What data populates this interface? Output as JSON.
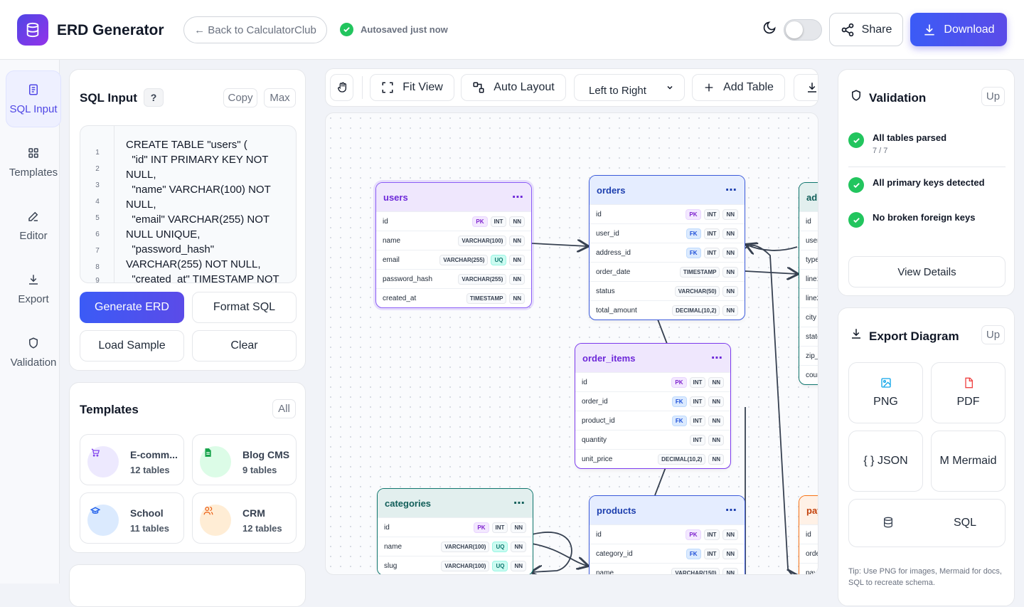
{
  "header": {
    "title": "ERD Generator",
    "back_label": "← Back to CalculatorClub",
    "autosave_text": "Autosaved just now",
    "share_label": "Share",
    "download_label": "Download",
    "accent": "#4f46e5"
  },
  "rail": [
    "SQL Input",
    "Templates",
    "Editor",
    "Export",
    "Validation"
  ],
  "sql_input": {
    "title": "SQL Input",
    "help": "?",
    "copy_label": "Copy",
    "max_label": "Max",
    "line_numbers": [
      "1",
      "2",
      "3",
      "4",
      "5",
      "6",
      "7",
      "8",
      "9"
    ],
    "code": "CREATE TABLE \"users\" (\n  \"id\" INT PRIMARY KEY NOT NULL,\n  \"name\" VARCHAR(100) NOT NULL,\n  \"email\" VARCHAR(255) NOT NULL UNIQUE,\n  \"password_hash\" VARCHAR(255) NOT NULL,\n  \"created_at\" TIMESTAMP NOT NULL",
    "generate": "Generate ERD",
    "format": "Format SQL",
    "load_sample": "Load Sample",
    "clear": "Clear"
  },
  "templates": {
    "title": "Templates",
    "all_label": "All",
    "items": [
      {
        "name": "E-comm...",
        "count": "12 tables"
      },
      {
        "name": "Blog CMS",
        "count": "9 tables"
      },
      {
        "name": "School",
        "count": "11 tables"
      },
      {
        "name": "CRM",
        "count": "12 tables"
      }
    ]
  },
  "toolbar": {
    "fit_view": "Fit View",
    "auto_layout": "Auto Layout",
    "direction": "Left to Right",
    "add_table": "Add Table"
  },
  "diagram": {
    "tables": [
      {
        "name": "users",
        "columns": [
          {
            "n": "id",
            "b": [
              "PK",
              "INT",
              "NN"
            ]
          },
          {
            "n": "name",
            "b": [
              "VARCHAR(100)",
              "NN"
            ]
          },
          {
            "n": "email",
            "b": [
              "VARCHAR(255)",
              "UQ",
              "NN"
            ]
          },
          {
            "n": "password_hash",
            "b": [
              "VARCHAR(255)",
              "NN"
            ]
          },
          {
            "n": "created_at",
            "b": [
              "TIMESTAMP",
              "NN"
            ]
          }
        ]
      },
      {
        "name": "orders",
        "columns": [
          {
            "n": "id",
            "b": [
              "PK",
              "INT",
              "NN"
            ]
          },
          {
            "n": "user_id",
            "b": [
              "FK",
              "INT",
              "NN"
            ]
          },
          {
            "n": "address_id",
            "b": [
              "FK",
              "INT",
              "NN"
            ]
          },
          {
            "n": "order_date",
            "b": [
              "TIMESTAMP",
              "NN"
            ]
          },
          {
            "n": "status",
            "b": [
              "VARCHAR(50)",
              "NN"
            ]
          },
          {
            "n": "total_amount",
            "b": [
              "DECIMAL(10,2)",
              "NN"
            ]
          }
        ]
      },
      {
        "name": "order_items",
        "columns": [
          {
            "n": "id",
            "b": [
              "PK",
              "INT",
              "NN"
            ]
          },
          {
            "n": "order_id",
            "b": [
              "FK",
              "INT",
              "NN"
            ]
          },
          {
            "n": "product_id",
            "b": [
              "FK",
              "INT",
              "NN"
            ]
          },
          {
            "n": "quantity",
            "b": [
              "INT",
              "NN"
            ]
          },
          {
            "n": "unit_price",
            "b": [
              "DECIMAL(10,2)",
              "NN"
            ]
          }
        ]
      },
      {
        "name": "categories",
        "columns": [
          {
            "n": "id",
            "b": [
              "PK",
              "INT",
              "NN"
            ]
          },
          {
            "n": "name",
            "b": [
              "VARCHAR(100)",
              "UQ",
              "NN"
            ]
          },
          {
            "n": "slug",
            "b": [
              "VARCHAR(100)",
              "UQ",
              "NN"
            ]
          }
        ]
      },
      {
        "name": "products",
        "columns": [
          {
            "n": "id",
            "b": [
              "PK",
              "INT",
              "NN"
            ]
          },
          {
            "n": "category_id",
            "b": [
              "FK",
              "INT",
              "NN"
            ]
          },
          {
            "n": "name",
            "b": [
              "VARCHAR(150)",
              "NN"
            ]
          }
        ]
      },
      {
        "name": "ad",
        "columns": [
          {
            "n": "id",
            "b": []
          },
          {
            "n": "user",
            "b": []
          },
          {
            "n": "type",
            "b": []
          },
          {
            "n": "line1",
            "b": []
          },
          {
            "n": "line2",
            "b": []
          },
          {
            "n": "city",
            "b": []
          },
          {
            "n": "state",
            "b": []
          },
          {
            "n": "zip_c",
            "b": []
          },
          {
            "n": "coun",
            "b": []
          }
        ]
      },
      {
        "name": "pay",
        "columns": [
          {
            "n": "id",
            "b": []
          },
          {
            "n": "orde",
            "b": []
          },
          {
            "n": "pay",
            "b": []
          }
        ]
      }
    ]
  },
  "validation": {
    "title": "Validation",
    "up_label": "Up",
    "items": [
      {
        "title": "All tables parsed",
        "sub": "7 / 7"
      },
      {
        "title": "All primary keys detected",
        "sub": ""
      },
      {
        "title": "No broken foreign keys",
        "sub": ""
      }
    ],
    "view_details": "View Details"
  },
  "export": {
    "title": "Export Diagram",
    "up_label": "Up",
    "items": [
      "PNG",
      "PDF",
      "{ } JSON",
      "M Mermaid",
      "SQL"
    ],
    "tip": "Tip: Use PNG for images, Mermaid for docs, SQL to recreate schema."
  }
}
